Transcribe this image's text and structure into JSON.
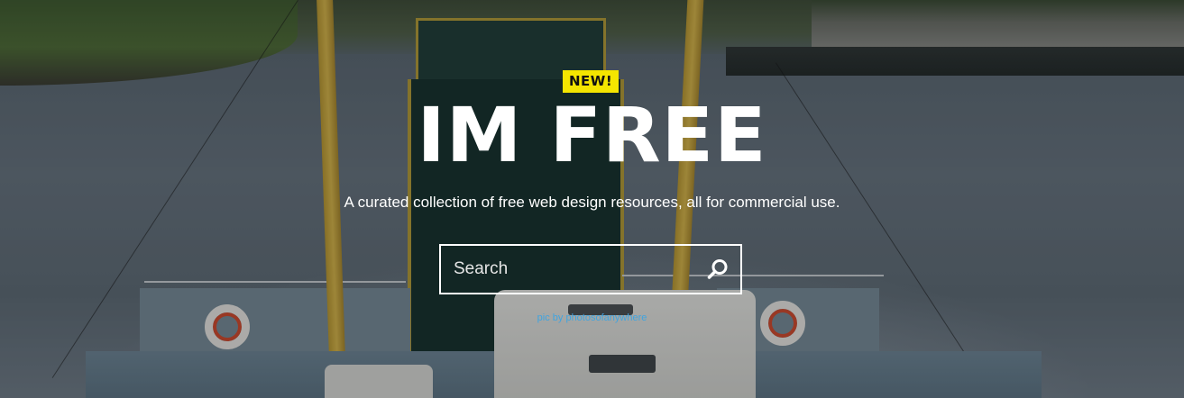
{
  "hero": {
    "badge": "NEW!",
    "title": "IM FREE",
    "tagline": "A curated collection of free web design resources, all for commercial use."
  },
  "search": {
    "placeholder": "Search",
    "value": "",
    "icon": "search-icon"
  },
  "credit": {
    "text": "pic by photosofanywhere"
  },
  "colors": {
    "badge_bg": "#f4e500",
    "title": "#ffffff",
    "credit_link": "#3fa4e0"
  }
}
